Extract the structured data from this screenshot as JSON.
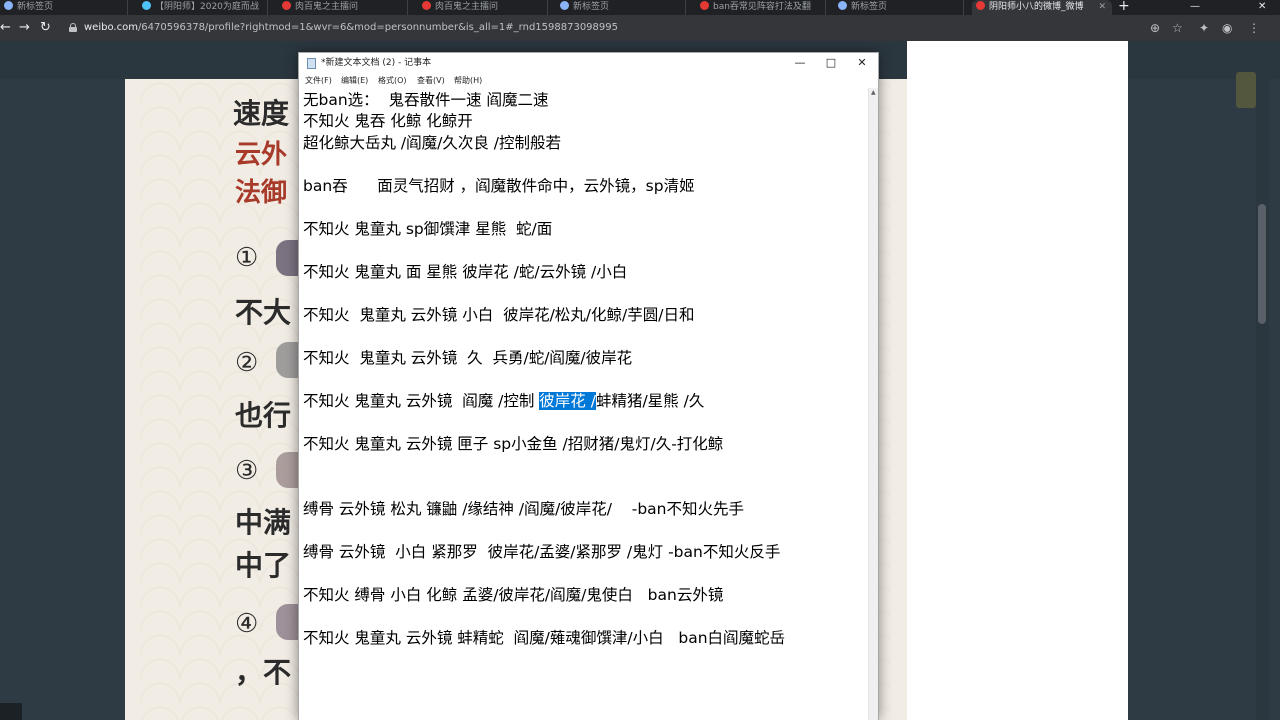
{
  "tabs": [
    {
      "title": "新标签页",
      "color": "#8ab4f8"
    },
    {
      "title": "【阴阳师】2020为庭而战",
      "color": "#4fc3f7"
    },
    {
      "title": "肉百鬼之主擂问",
      "color": "#e53935"
    },
    {
      "title": "肉百鬼之主擂问",
      "color": "#e53935"
    },
    {
      "title": "新标签页",
      "color": "#8ab4f8"
    },
    {
      "title": "ban吞常见阵容打法及翻",
      "color": "#e53935"
    },
    {
      "title": "新标签页",
      "color": "#8ab4f8"
    },
    {
      "title": "阴阳师小八的微博_微博",
      "color": "#e53935"
    }
  ],
  "window_controls": {
    "minimize": "—",
    "close": "✕"
  },
  "address_bar": {
    "host": "weibo.com",
    "path": "/6470596378/profile?rightmod=1&wvr=6&mod=personnumber&is_all=1#_rnd1598873098995"
  },
  "article": {
    "title_part": "速度",
    "red_line1": "云外",
    "red_line2": "法御",
    "numbers": [
      "①",
      "②",
      "③",
      "④"
    ],
    "text1": "不大",
    "text2": "也行",
    "text3": "中满",
    "text4": "中了",
    "text5": "，不"
  },
  "notepad": {
    "title": "*新建文本文档 (2) - 记事本",
    "menu": [
      "文件(F)",
      "编辑(E)",
      "格式(O)",
      "查看(V)",
      "帮助(H)"
    ],
    "lines": [
      "无ban选：  鬼吞散件一速 阎魔二速",
      "不知火 鬼吞 化鲸 化鲸开",
      "超化鲸大岳丸 /阎魔/久次良 /控制般若",
      "",
      "ban吞      面灵气招财 ，阎魔散件命中，云外镜，sp清姬",
      "",
      "不知火 鬼童丸 sp御馔津 星熊  蛇/面",
      "",
      "不知火 鬼童丸 面 星熊 彼岸花 /蛇/云外镜 /小白",
      "",
      "不知火  鬼童丸 云外镜 小白  彼岸花/松丸/化鲸/芋圆/日和",
      "",
      "不知火  鬼童丸 云外镜  久  兵勇/蛇/阎魔/彼岸花",
      "",
      "",
      "",
      "不知火 鬼童丸 云外镜 匣子 sp小金鱼 /招财猪/鬼灯/久-打化鲸",
      "",
      "",
      "缚骨 云外镜 松丸 镰鼬 /缘结神 /阎魔/彼岸花/    -ban不知火先手",
      "",
      "缚骨 云外镜  小白 紧那罗  彼岸花/孟婆/紧那罗 /鬼灯 -ban不知火反手",
      "",
      "不知火 缚骨 小白 化鲸 孟婆/彼岸花/阎魔/鬼使白   ban云外镜",
      "",
      "不知火 鬼童丸 云外镜 蚌精蛇  阎魔/薙魂御馔津/小白   ban白阎魔蛇岳"
    ],
    "selected_line": {
      "before": "不知火 鬼童丸 云外镜  阎魔 /控制 ",
      "selected": "彼岸花 /",
      "after": "蚌精猪/星熊 /久"
    }
  }
}
